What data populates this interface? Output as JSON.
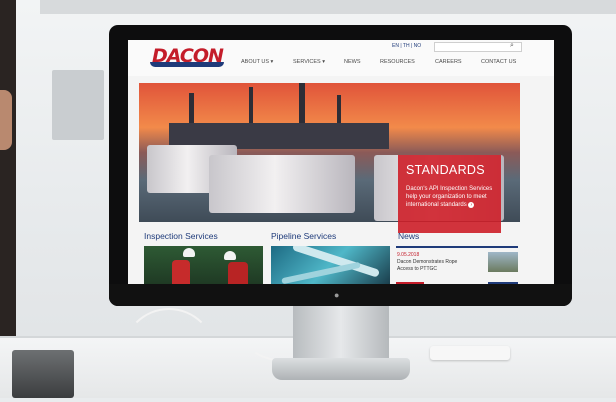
{
  "site": {
    "logo_text": "DACON",
    "language": "EN | TH | NO",
    "nav": [
      "ABOUT US ▾",
      "SERVICES ▾",
      "NEWS",
      "RESOURCES",
      "CAREERS",
      "CONTACT US"
    ],
    "hero": {
      "title": "STANDARDS",
      "text": "Dacon's API Inspection Services help your organization to meet international standards"
    },
    "sections": {
      "inspection": "Inspection Services",
      "pipeline": "Pipeline Services",
      "news": "News"
    },
    "news_item": {
      "date": "9.05.2018",
      "text": "Dacon Demonstrates Rope Access to PTTGC"
    }
  },
  "colors": {
    "brand_red": "#c41d2a",
    "brand_blue": "#1f3b7a"
  }
}
